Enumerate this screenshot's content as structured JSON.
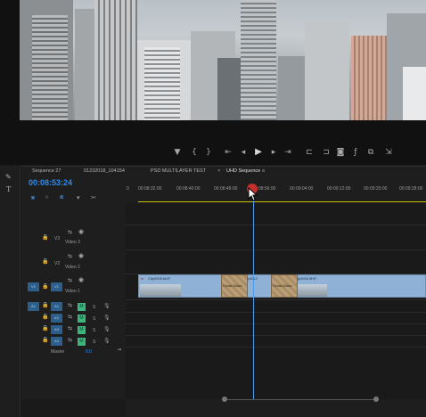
{
  "timeline": {
    "tabs": [
      "Sequence 27",
      "01232018_104154",
      "PSD MULTILAYER TEST",
      "×",
      "UHD Sequence",
      "≡"
    ],
    "timecode": "00:08:53:24",
    "ruler": [
      "0",
      "00:08:32:00",
      "00:08:40:00",
      "00:08:48:00",
      "00:08:56:00",
      "00:09:04:00",
      "00:09:12:00",
      "00:09:20:00",
      "00:09:28:00"
    ]
  },
  "tracks": {
    "v3": {
      "id": "V3",
      "name": "Video 3"
    },
    "v2": {
      "id": "V2",
      "name": "Video 2"
    },
    "v1": {
      "id": "V1",
      "name": "Video 1",
      "src": "V1"
    },
    "a1": {
      "id": "A1",
      "src": "A1",
      "m": "M",
      "s": "S"
    },
    "a2": {
      "id": "A2",
      "m": "M",
      "s": "S"
    },
    "a3": {
      "id": "A3",
      "m": "M",
      "s": "S"
    },
    "a4": {
      "id": "A4",
      "m": "M",
      "s": "S"
    },
    "master": {
      "label": "Master",
      "value": "0.0"
    }
  },
  "clips": [
    {
      "label": "Clip0005.MXF"
    },
    {
      "label": "Clip0012"
    },
    {
      "label": "Clip0005.MXF"
    }
  ],
  "transitions": [
    {
      "label": "Cross Disso"
    },
    {
      "label": "Cross Disso"
    }
  ]
}
